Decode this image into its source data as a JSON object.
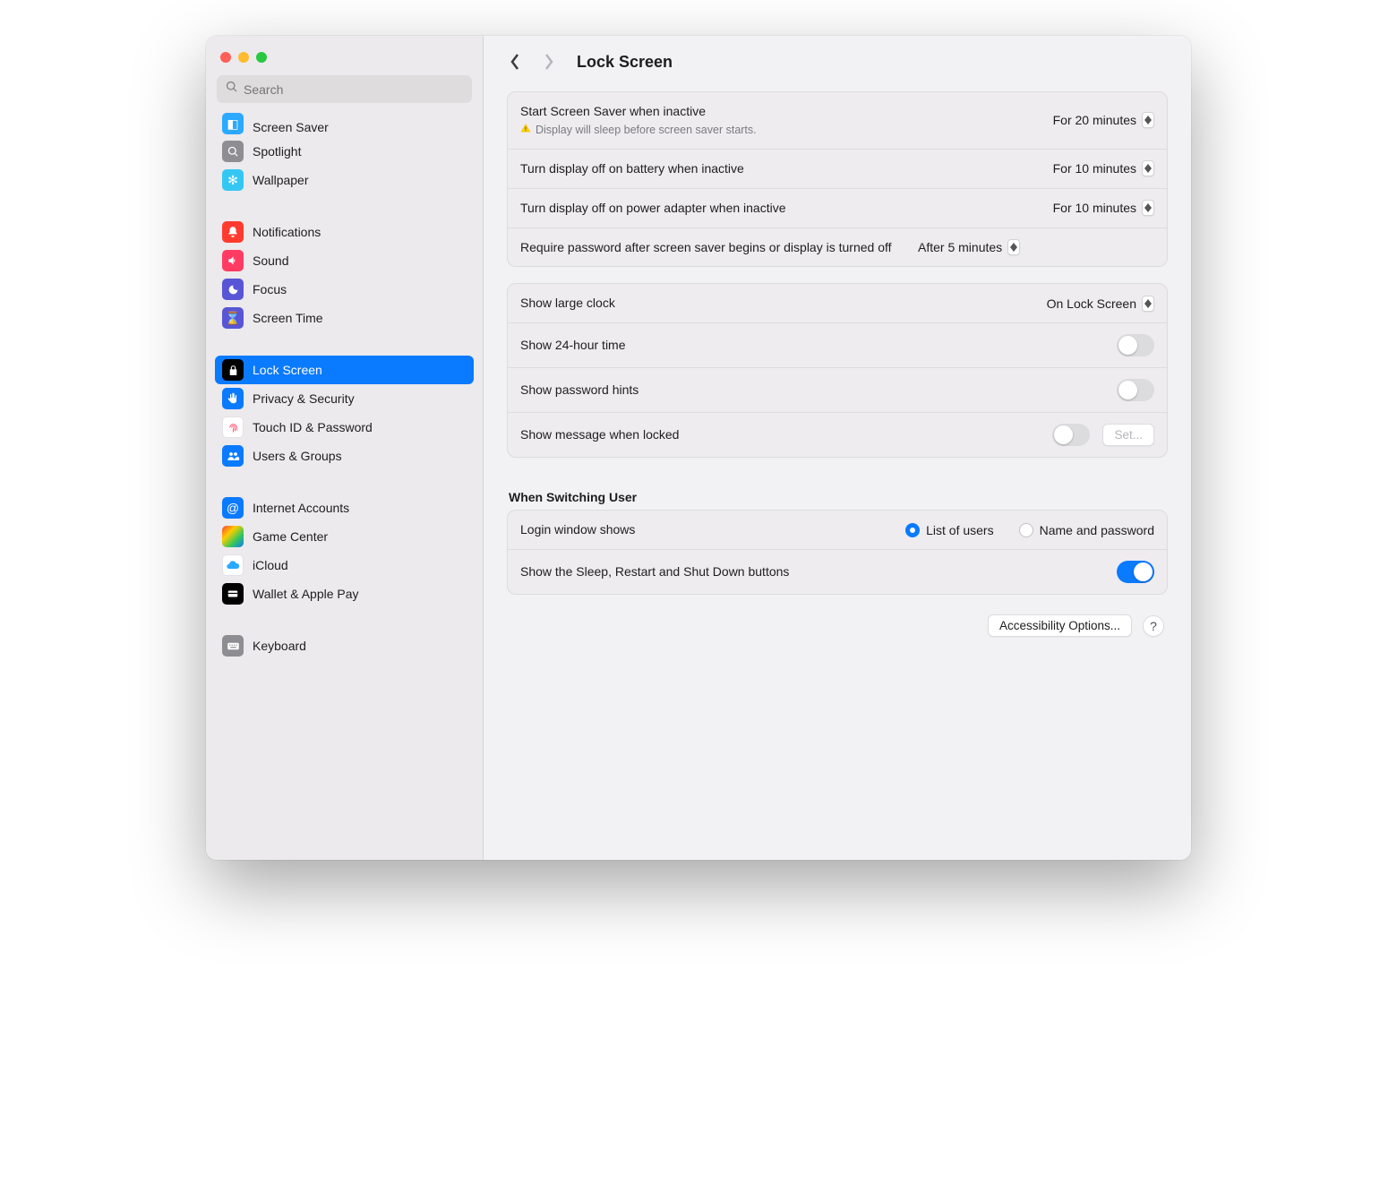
{
  "search": {
    "placeholder": "Search"
  },
  "header": {
    "title": "Lock Screen"
  },
  "sidebar": {
    "groups": [
      {
        "items": [
          {
            "label": "Screen Saver"
          },
          {
            "label": "Spotlight"
          },
          {
            "label": "Wallpaper"
          }
        ]
      },
      {
        "items": [
          {
            "label": "Notifications"
          },
          {
            "label": "Sound"
          },
          {
            "label": "Focus"
          },
          {
            "label": "Screen Time"
          }
        ]
      },
      {
        "items": [
          {
            "label": "Lock Screen"
          },
          {
            "label": "Privacy & Security"
          },
          {
            "label": "Touch ID & Password"
          },
          {
            "label": "Users & Groups"
          }
        ]
      },
      {
        "items": [
          {
            "label": "Internet Accounts"
          },
          {
            "label": "Game Center"
          },
          {
            "label": "iCloud"
          },
          {
            "label": "Wallet & Apple Pay"
          }
        ]
      },
      {
        "items": [
          {
            "label": "Keyboard"
          }
        ]
      }
    ]
  },
  "settings": {
    "screenSaver": {
      "label": "Start Screen Saver when inactive",
      "value": "For 20 minutes",
      "warning": "Display will sleep before screen saver starts."
    },
    "battery": {
      "label": "Turn display off on battery when inactive",
      "value": "For 10 minutes"
    },
    "adapter": {
      "label": "Turn display off on power adapter when inactive",
      "value": "For 10 minutes"
    },
    "password": {
      "label": "Require password after screen saver begins or display is turned off",
      "value": "After 5 minutes"
    },
    "clock": {
      "label": "Show large clock",
      "value": "On Lock Screen"
    },
    "hour24": {
      "label": "Show 24-hour time"
    },
    "hints": {
      "label": "Show password hints"
    },
    "message": {
      "label": "Show message when locked",
      "button": "Set..."
    },
    "switchTitle": "When Switching User",
    "loginShows": {
      "label": "Login window shows",
      "opt1": "List of users",
      "opt2": "Name and password"
    },
    "sleepButtons": {
      "label": "Show the Sleep, Restart and Shut Down buttons"
    },
    "accessibility": "Accessibility Options..."
  }
}
